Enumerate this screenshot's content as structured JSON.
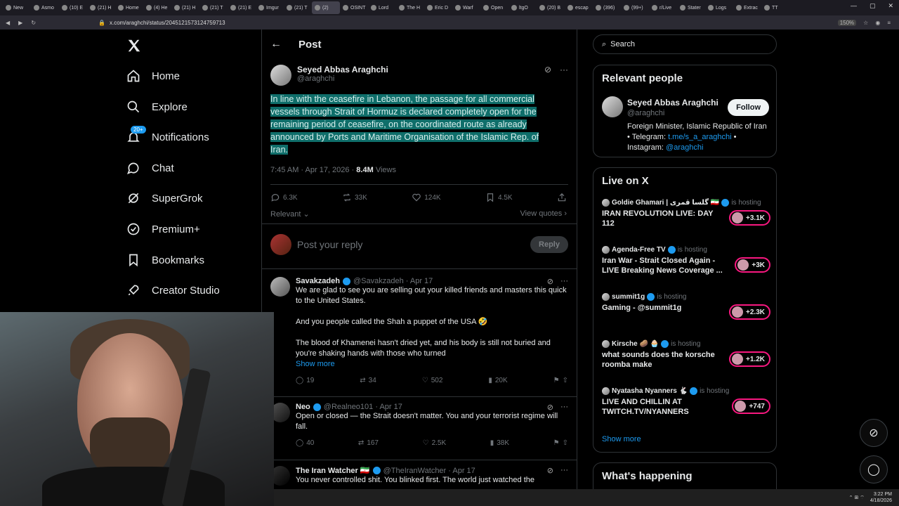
{
  "browser": {
    "tabs": [
      "New",
      "Asmo",
      "(10) E",
      "(21) H",
      "Home",
      "(4) He",
      "(21) H",
      "(21) T",
      "(21) E",
      "Imgur",
      "(21) T",
      "(2)",
      "OSINT",
      "Lord",
      "The H",
      "Eric D",
      "Warf",
      "Open",
      "ltgO",
      "(20) B",
      "escap",
      "(396)",
      "(99+)",
      "r/Live",
      "Stater",
      "Logs",
      "Extrac",
      "TT"
    ],
    "url": "x.com/araghchi/status/2045121573124759713",
    "zoom": "150%",
    "clock_time": "3:22 PM",
    "clock_date": "4/18/2026"
  },
  "nav": {
    "items": [
      {
        "label": "Home",
        "icon": "home-icon"
      },
      {
        "label": "Explore",
        "icon": "search-icon"
      },
      {
        "label": "Notifications",
        "icon": "bell-icon",
        "badge": "20+"
      },
      {
        "label": "Chat",
        "icon": "chat-icon"
      },
      {
        "label": "SuperGrok",
        "icon": "grok-icon"
      },
      {
        "label": "Premium+",
        "icon": "verified-icon"
      },
      {
        "label": "Bookmarks",
        "icon": "bookmark-icon"
      },
      {
        "label": "Creator Studio",
        "icon": "rocket-icon"
      }
    ]
  },
  "post": {
    "header_title": "Post",
    "author_name": "Seyed Abbas Araghchi",
    "author_handle": "@araghchi",
    "text": "In line with the ceasefire in Lebanon, the passage for all commercial vessels through Strait of Hormuz is declared completely open for the remaining period of ceasefire, on the coordinated route as already announced by Ports and Maritime Organisation of the Islamic Rep. of Iran.",
    "timestamp": "7:45 AM · Apr 17, 2026 · ",
    "views_count": "8.4M",
    "views_label": " Views",
    "replies": "6.3K",
    "reposts": "33K",
    "likes": "124K",
    "bookmarks": "4.5K",
    "sort_label": "Relevant",
    "view_quotes": "View quotes",
    "reply_placeholder": "Post your reply",
    "reply_button": "Reply"
  },
  "replies": [
    {
      "name": "Savakzadeh",
      "handle": "@Savakzadeh · Apr 17",
      "lines": [
        "We are glad to see you are selling out your killed friends and masters this quick to the United States.",
        "And you people called the Shah a puppet of the USA 🤣",
        "The blood of Khamenei hasn't dried yet, and his body is still not buried and you're shaking hands with those who turned"
      ],
      "show_more": "Show more",
      "replies": "19",
      "reposts": "34",
      "likes": "502",
      "views": "20K"
    },
    {
      "name": "Neo",
      "handle": "@Realneo101 · Apr 17",
      "lines": [
        "Open or closed — the Strait doesn't matter. You and your terrorist regime will fall."
      ],
      "replies": "40",
      "reposts": "167",
      "likes": "2.5K",
      "views": "38K"
    },
    {
      "name": "The Iran Watcher 🇮🇷",
      "handle": "@TheIranWatcher · Apr 17",
      "lines": [
        "You never controlled shit. You blinked first. The world just watched the"
      ]
    }
  ],
  "sidebar": {
    "search_placeholder": "Search",
    "relevant_title": "Relevant people",
    "person_name": "Seyed Abbas Araghchi",
    "person_handle": "@araghchi",
    "follow_label": "Follow",
    "bio_text": "Foreign Minister, Islamic Republic of Iran • Telegram: ",
    "bio_link1": "t.me/s_a_araghchi",
    "bio_mid": " • Instagram: ",
    "bio_link2": "@araghchi",
    "live_title": "Live on X",
    "live_items": [
      {
        "host": "Goldie Ghamari | گلسا قمری 🇮🇷",
        "status": "is hosting",
        "title": "IRAN REVOLUTION LIVE: DAY 112",
        "count": "+3.1K"
      },
      {
        "host": "Agenda-Free TV",
        "status": "is hosting",
        "title": "Iran War - Strait Closed Again - LIVE Breaking News Coverage ...",
        "count": "+3K"
      },
      {
        "host": "summit1g",
        "status": "is hosting",
        "title": "Gaming - @summit1g",
        "count": "+2.3K"
      },
      {
        "host": "Kirsche 🥔 🧁",
        "status": "is hosting",
        "title": "what sounds does the korsche roomba make",
        "count": "+1.2K"
      },
      {
        "host": "Nyatasha Nyanners 🐇",
        "status": "is hosting",
        "title": "LIVE AND CHILLIN AT TWITCH.TV/NYANNERS",
        "count": "+747"
      }
    ],
    "show_more": "Show more",
    "happening_title": "What's happening"
  }
}
